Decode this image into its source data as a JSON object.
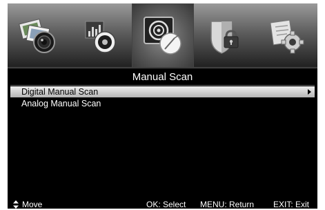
{
  "tabs": [
    {
      "icon": "picture-icon",
      "selected": false
    },
    {
      "icon": "sound-icon",
      "selected": false
    },
    {
      "icon": "channel-icon",
      "selected": true
    },
    {
      "icon": "lock-icon",
      "selected": false
    },
    {
      "icon": "setup-icon",
      "selected": false
    }
  ],
  "menu": {
    "title": "Manual Scan",
    "items": [
      {
        "label": "Digital Manual Scan",
        "selected": true,
        "has_submenu": true
      },
      {
        "label": "Analog Manual Scan",
        "selected": false,
        "has_submenu": false
      }
    ]
  },
  "footer": {
    "move": "Move",
    "select": "OK: Select",
    "return": "MENU: Return",
    "exit": "EXIT: Exit",
    "move_icon": "up-down-arrows-icon"
  },
  "colors": {
    "background": "#000000",
    "highlight": "#d4d4d4",
    "text": "#ffffff"
  }
}
